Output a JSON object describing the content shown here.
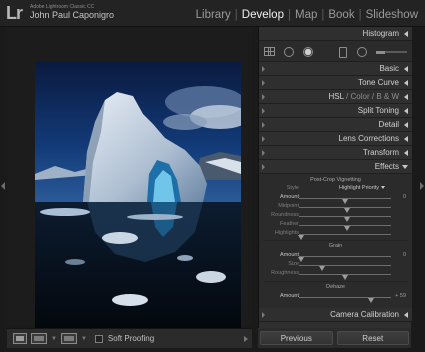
{
  "app": {
    "logo": "Lr",
    "subtitle": "Adobe Lightroom Classic CC",
    "owner": "John Paul Caponigro"
  },
  "modules": [
    {
      "label": "Library",
      "active": false
    },
    {
      "label": "Develop",
      "active": true
    },
    {
      "label": "Map",
      "active": false
    },
    {
      "label": "Book",
      "active": false
    },
    {
      "label": "Slideshow",
      "active": false
    }
  ],
  "toolbar": {
    "soft_proofing_label": "Soft Proofing"
  },
  "panel": {
    "histogram": "Histogram",
    "basic": "Basic",
    "tone_curve": "Tone Curve",
    "hsl": {
      "hsl": "HSL",
      "sep": "/",
      "color": "Color",
      "bw": "B & W"
    },
    "split_toning": "Split Toning",
    "detail": "Detail",
    "lens_corrections": "Lens Corrections",
    "transform": "Transform",
    "effects": "Effects",
    "camera_calibration": "Camera Calibration"
  },
  "effects": {
    "vignette_title": "Post-Crop Vignetting",
    "style_label": "Style",
    "style_value": "Highlight Priority",
    "vignette_rows": [
      {
        "label": "Amount",
        "value": "0",
        "pos": 0.5,
        "on": true
      },
      {
        "label": "Midpoint",
        "value": "",
        "pos": 0.52,
        "on": false
      },
      {
        "label": "Roundness",
        "value": "",
        "pos": 0.52,
        "on": false
      },
      {
        "label": "Feather",
        "value": "",
        "pos": 0.52,
        "on": false
      },
      {
        "label": "Highlights",
        "value": "",
        "pos": 0.02,
        "on": false
      }
    ],
    "grain_title": "Grain",
    "grain_rows": [
      {
        "label": "Amount",
        "value": "0",
        "pos": 0.02,
        "on": true
      },
      {
        "label": "Size",
        "value": "",
        "pos": 0.25,
        "on": false
      },
      {
        "label": "Roughness",
        "value": "",
        "pos": 0.5,
        "on": false
      }
    ],
    "dehaze_title": "Dehaze",
    "dehaze_row": {
      "label": "Amount",
      "value": "+ 59",
      "pos": 0.78,
      "on": true
    }
  },
  "buttons": {
    "previous": "Previous",
    "reset": "Reset"
  },
  "colors": {
    "background": "#1a1a1a",
    "panel": "#2f2f2f",
    "active_module": "#f1f1f1",
    "inactive_module": "#9a9a9a"
  }
}
